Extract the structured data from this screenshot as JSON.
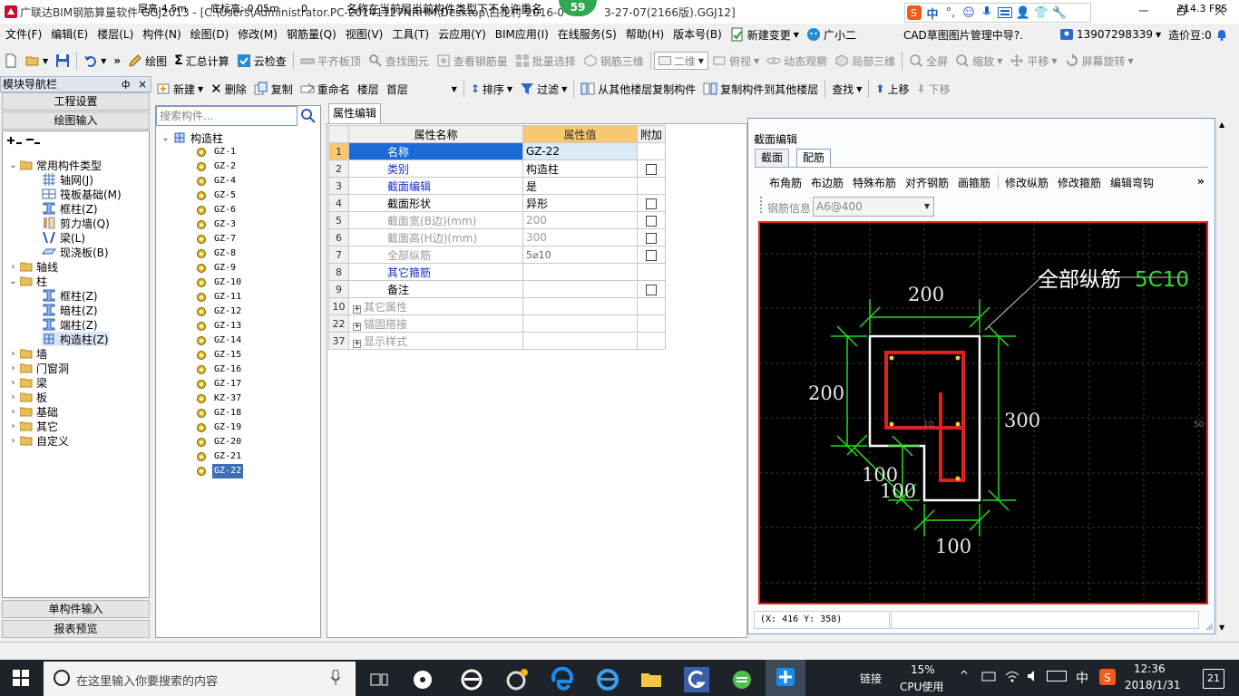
{
  "window": {
    "title": "广联达BIM钢筋算量软件 GGJ2013 - [C:\\Users\\Administrator.PC-20141127NRHM\\Desktop\\白龙村-2016-0",
    "title_tail": "3-27-07(2166版).GGJ12]",
    "badge": "59"
  },
  "menu": [
    "文件(F)",
    "编辑(E)",
    "楼层(L)",
    "构件(N)",
    "绘图(D)",
    "修改(M)",
    "钢筋量(Q)",
    "视图(V)",
    "工具(T)",
    "云应用(Y)",
    "BIM应用(I)",
    "在线服务(S)",
    "帮助(H)",
    "版本号(B)"
  ],
  "menu_right": {
    "change": "新建变更",
    "assistant": "广小二",
    "cad_mgr": "CAD草图图片管理中导?.",
    "phone": "13907298339",
    "beans": "造价豆:0"
  },
  "toolbar1": {
    "draw": "绘图",
    "calc": "汇总计算",
    "cloud_check": "云检查",
    "flat_top": "平齐板顶",
    "find_elem": "查找图元",
    "view_rebar": "查看钢筋量",
    "batch_select": "批量选择",
    "rebar3d": "钢筋三维",
    "view_mode": "二维",
    "top_view": "俯视",
    "dyn_view": "动态观察",
    "local3d": "局部三维",
    "fullscreen": "全屏",
    "zoom": "缩放",
    "pan": "平移",
    "rotate": "屏幕旋转"
  },
  "toolbar2": {
    "new": "新建",
    "delete": "删除",
    "copy": "复制",
    "rename": "重命名",
    "floor_label": "楼层",
    "floor_value": "首层",
    "sort": "排序",
    "filter": "过滤",
    "copy_from": "从其他楼层复制构件",
    "copy_to": "复制构件到其他楼层",
    "find": "查找",
    "move_up": "上移",
    "move_down": "下移"
  },
  "nav": {
    "title": "模块导航栏",
    "pin": "ф",
    "close": "×",
    "btn_project": "工程设置",
    "btn_draw": "绘图输入",
    "btn_single": "单构件输入",
    "btn_report": "报表预览",
    "tree": {
      "common": "常用构件类型",
      "axis_grid": "轴网(J)",
      "raft": "筏板基础(M)",
      "frame_col": "框柱(Z)",
      "shear_wall": "剪力墙(Q)",
      "beam": "梁(L)",
      "cast_slab": "现浇板(B)",
      "axis": "轴线",
      "column": "柱",
      "col_frame": "框柱(Z)",
      "col_hidden": "暗柱(Z)",
      "col_end": "端柱(Z)",
      "col_struct": "构造柱(Z)",
      "wall": "墙",
      "door_window": "门窗洞",
      "beam2": "梁",
      "slab": "板",
      "foundation": "基础",
      "other": "其它",
      "custom": "自定义"
    }
  },
  "comp_list": {
    "search_placeholder": "搜索构件...",
    "root": "构造柱",
    "items": [
      "GZ-1",
      "GZ-2",
      "GZ-4",
      "GZ-5",
      "GZ-6",
      "GZ-3",
      "GZ-7",
      "GZ-8",
      "GZ-9",
      "GZ-10",
      "GZ-11",
      "GZ-12",
      "GZ-13",
      "GZ-14",
      "GZ-15",
      "GZ-16",
      "GZ-17",
      "KZ-37",
      "GZ-18",
      "GZ-19",
      "GZ-20",
      "GZ-21",
      "GZ-22"
    ],
    "selected": "GZ-22"
  },
  "props": {
    "tab": "属性编辑",
    "headers": {
      "name": "属性名称",
      "value": "属性值",
      "add": "附加"
    },
    "rows": [
      {
        "idx": "1",
        "name": "名称",
        "value": "GZ-22"
      },
      {
        "idx": "2",
        "name": "类别",
        "value": "构造柱"
      },
      {
        "idx": "3",
        "name": "截面编辑",
        "value": "是"
      },
      {
        "idx": "4",
        "name": "截面形状",
        "value": "异形"
      },
      {
        "idx": "5",
        "name": "截面宽(B边)(mm)",
        "value": "200"
      },
      {
        "idx": "6",
        "name": "截面高(H边)(mm)",
        "value": "300"
      },
      {
        "idx": "7",
        "name": "全部纵筋",
        "value": "5⌀10"
      },
      {
        "idx": "8",
        "name": "其它箍筋",
        "value": ""
      },
      {
        "idx": "9",
        "name": "备注",
        "value": ""
      },
      {
        "idx": "10",
        "name": "其它属性",
        "value": ""
      },
      {
        "idx": "22",
        "name": "锚固搭接",
        "value": ""
      },
      {
        "idx": "37",
        "name": "显示样式",
        "value": ""
      }
    ]
  },
  "section": {
    "title": "截面编辑",
    "tab_section": "截面",
    "tab_rebar": "配筋",
    "tools": [
      "布角筋",
      "布边筋",
      "特殊布筋",
      "对齐钢筋",
      "画箍筋",
      "修改纵筋",
      "修改箍筋",
      "编辑弯钩"
    ],
    "more": "»",
    "info_label": "钢筋信息",
    "info_value": "A6@400",
    "annotation_label": "全部纵筋",
    "annotation_value": "5C10",
    "dims": {
      "top": "200",
      "left": "200",
      "right": "300",
      "notch_h": "100",
      "notch_v": "100",
      "bottom": "100"
    },
    "coord": "(X: 416 Y: 358)",
    "edge_left": "10",
    "edge_right": "50"
  },
  "status": {
    "floor_height": "层高:4.5m",
    "base_elev": "底标高:-0.05m",
    "zero": "0",
    "message": "名称在当前层当前构件类型下不允许重名",
    "fps": "214.3 FPS"
  },
  "taskbar": {
    "search_placeholder": "在这里输入你要搜索的内容",
    "link": "链接",
    "cpu_pct": "15%",
    "cpu_label": "CPU使用",
    "ime": "中",
    "time": "12:36",
    "date": "2018/1/31",
    "notif": "21"
  },
  "colors": {
    "accent_blue": "#3c6fb5",
    "rebar_red": "#e02020",
    "dim_green": "#22dd22",
    "annotation_green": "#33dd33",
    "canvas_bg": "#000000"
  }
}
